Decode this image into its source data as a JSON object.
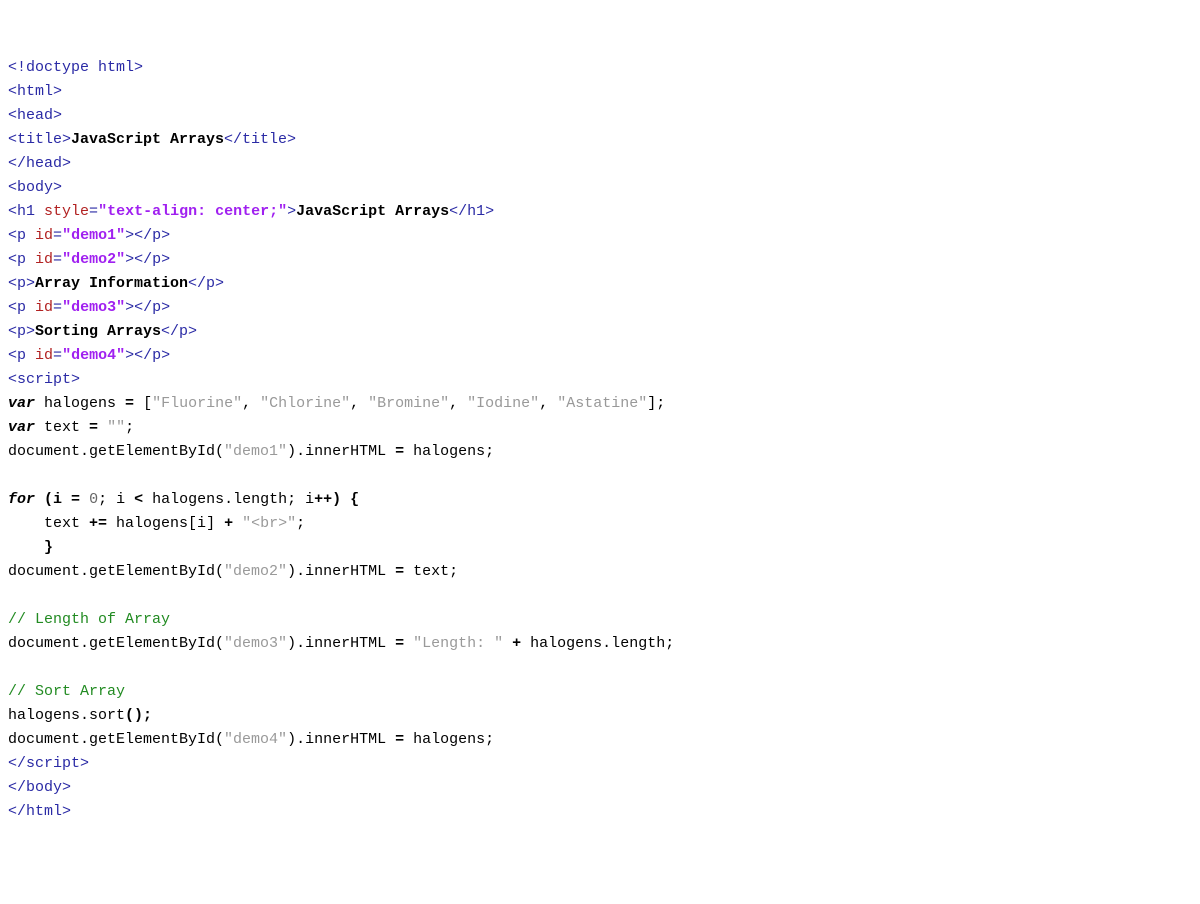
{
  "lines": {
    "l1": {
      "doctype": "<!doctype html>"
    },
    "l2": {
      "open_html": "<html>"
    },
    "l3": {
      "open_head": "<head>"
    },
    "l4": {
      "open_title": "<title>",
      "title_text": "JavaScript Arrays",
      "close_title": "</title>"
    },
    "l5": {
      "close_head": "</head>"
    },
    "l6": {
      "open_body": "<body>"
    },
    "l7": {
      "open_h1": "<h1",
      "sp1": " ",
      "attr_style": "style",
      "eq": "=",
      "style_val": "\"text-align: center;\"",
      "gt": ">",
      "h1_text": "JavaScript Arrays",
      "close_h1": "</h1>"
    },
    "l8": {
      "open_p": "<p",
      "sp": " ",
      "attr_id": "id",
      "eq": "=",
      "id_val": "\"demo1\"",
      "gt": ">",
      "close_p": "</p>"
    },
    "l9": {
      "open_p": "<p",
      "sp": " ",
      "attr_id": "id",
      "eq": "=",
      "id_val": "\"demo2\"",
      "gt": ">",
      "close_p": "</p>"
    },
    "l10": {
      "open_p": "<p>",
      "text": "Array Information",
      "close_p": "</p>"
    },
    "l11": {
      "open_p": "<p",
      "sp": " ",
      "attr_id": "id",
      "eq": "=",
      "id_val": "\"demo3\"",
      "gt": ">",
      "close_p": "</p>"
    },
    "l12": {
      "open_p": "<p>",
      "text": "Sorting Arrays",
      "close_p": "</p>"
    },
    "l13": {
      "open_p": "<p",
      "sp": " ",
      "attr_id": "id",
      "eq": "=",
      "id_val": "\"demo4\"",
      "gt": ">",
      "close_p": "</p>"
    },
    "l14": {
      "open_script": "<script>"
    },
    "l15": {
      "kw_var": "var",
      "sp": " ",
      "rest1": "halogens ",
      "op_eq": "=",
      "rest2": " [",
      "s1": "\"Fluorine\"",
      "c1": ", ",
      "s2": "\"Chlorine\"",
      "c2": ", ",
      "s3": "\"Bromine\"",
      "c3": ", ",
      "s4": "\"Iodine\"",
      "c4": ", ",
      "s5": "\"Astatine\"",
      "end": "];"
    },
    "l16": {
      "kw_var": "var",
      "sp": " ",
      "rest1": "text ",
      "op_eq": "=",
      "sp2": " ",
      "str": "\"\"",
      "semi": ";"
    },
    "l17": {
      "pre": "document.getElementById(",
      "str": "\"demo1\"",
      "mid": ").innerHTML ",
      "op_eq": "=",
      "post": " halogens;"
    },
    "l18": {
      "blank": ""
    },
    "l19": {
      "kw_for": "for",
      "sp": " ",
      "paren": "(i ",
      "op_eq": "=",
      "sp2": " ",
      "num": "0",
      "semi": "; i ",
      "op_lt": "<",
      "rest": " halogens.length; i",
      "op_pp": "++",
      "close": ") {"
    },
    "l20": {
      "indent": "    ",
      "pre": "text ",
      "op_pluseq": "+=",
      "mid": " halogens[i] ",
      "op_plus": "+",
      "sp": " ",
      "str": "\"<br>\"",
      "semi": ";"
    },
    "l21": {
      "indent": "    ",
      "brace": "}"
    },
    "l22": {
      "pre": "document.getElementById(",
      "str": "\"demo2\"",
      "mid": ").innerHTML ",
      "op_eq": "=",
      "post": " text;"
    },
    "l23": {
      "blank": ""
    },
    "l24": {
      "cmt": "// Length of Array"
    },
    "l25": {
      "pre": "document.getElementById(",
      "str": "\"demo3\"",
      "mid": ").innerHTML ",
      "op_eq": "=",
      "sp": " ",
      "str2": "\"Length: \"",
      "sp2": " ",
      "op_plus": "+",
      "post": " halogens.length;"
    },
    "l26": {
      "blank": ""
    },
    "l27": {
      "cmt": "// Sort Array"
    },
    "l28": {
      "pre": "halogens.sort",
      "op": "();"
    },
    "l29": {
      "pre": "document.getElementById(",
      "str": "\"demo4\"",
      "mid": ").innerHTML ",
      "op_eq": "=",
      "post": " halogens;"
    },
    "l30": {
      "close_script": "</sc",
      "close_script2": "ript>"
    },
    "l31": {
      "close_body": "</body>"
    },
    "l32": {
      "close_html": "</html>"
    }
  }
}
